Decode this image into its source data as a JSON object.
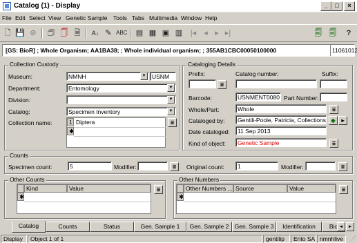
{
  "window": {
    "title": "Catalog (1) - Display",
    "min": "_",
    "max": "□",
    "close": "×"
  },
  "menu": [
    "File",
    "Edit",
    "Select",
    "View",
    "Genetic Sample",
    "Tools",
    "Tabs",
    "Multimedia",
    "Window",
    "Help"
  ],
  "toolbar": {
    "nav_first": "|◂",
    "nav_prev": "◂",
    "nav_next": "▸",
    "nav_last": "▸|",
    "help": "?"
  },
  "record": {
    "summary": "[GS: BioR] ; Whole Organism; AA1BA38; ; Whole individual organism; ; 355AB1CBC00050100000",
    "id": "11061012"
  },
  "custody": {
    "title": "Collection Custody",
    "museum_label": "Museum:",
    "museum": "NMNH",
    "museum_code": "USNM",
    "department_label": "Department:",
    "department": "Entomology",
    "division_label": "Division:",
    "division": "",
    "catalog_label": "Catalog:",
    "catalog": "Specimen Inventory",
    "collname_label": "Collection name:",
    "collname_row": "1",
    "collname": "Diptera",
    "new_row": "✱"
  },
  "details": {
    "title": "Cataloging Details",
    "prefix_label": "Prefix:",
    "catnum_label": "Catalog number:",
    "suffix_label": "Suffix:",
    "prefix": "",
    "catnum": "",
    "suffix": "",
    "barcode_label": "Barcode:",
    "barcode": "USNMENT0080",
    "partnum_label": "Part Number:",
    "partnum": "",
    "wholepart_label": "Whole/Part:",
    "wholepart": "Whole",
    "catby_label": "Cataloged by:",
    "catby": "Gentili-Poole, Patricia, Collections In",
    "date_label": "Date cataloged:",
    "date": "11 Sep 2013",
    "kind_label": "Kind of object:",
    "kind": "Genetic Sample"
  },
  "counts": {
    "title": "Counts",
    "specimen_label": "Specimen count:",
    "specimen": "5",
    "modifier_label": "Modifier:",
    "modifier": "",
    "original_label": "Original count:",
    "original": "1",
    "modifier2_label": "Modifier:",
    "modifier2": ""
  },
  "other_counts": {
    "title": "Other Counts",
    "cols": [
      "Kind",
      "Value"
    ],
    "new_row": "✱"
  },
  "other_numbers": {
    "title": "Other Numbers",
    "cols": [
      "Other Numbers ...",
      "Source",
      "Value"
    ],
    "new_row": "✱"
  },
  "tabs": [
    "Catalog",
    "Counts",
    "Status",
    "Gen. Sample 1",
    "Gen. Sample 2",
    "Gen. Sample 3",
    "Identification",
    "Bio"
  ],
  "status": {
    "mode": "Display",
    "position": "Object 1 of 1",
    "user": "gentilip",
    "group": "Ento SA",
    "db": "nmnhlive"
  },
  "colors": {
    "title_text": "#000000",
    "kind_text": "#e00000",
    "face": "#d4d0c8"
  }
}
